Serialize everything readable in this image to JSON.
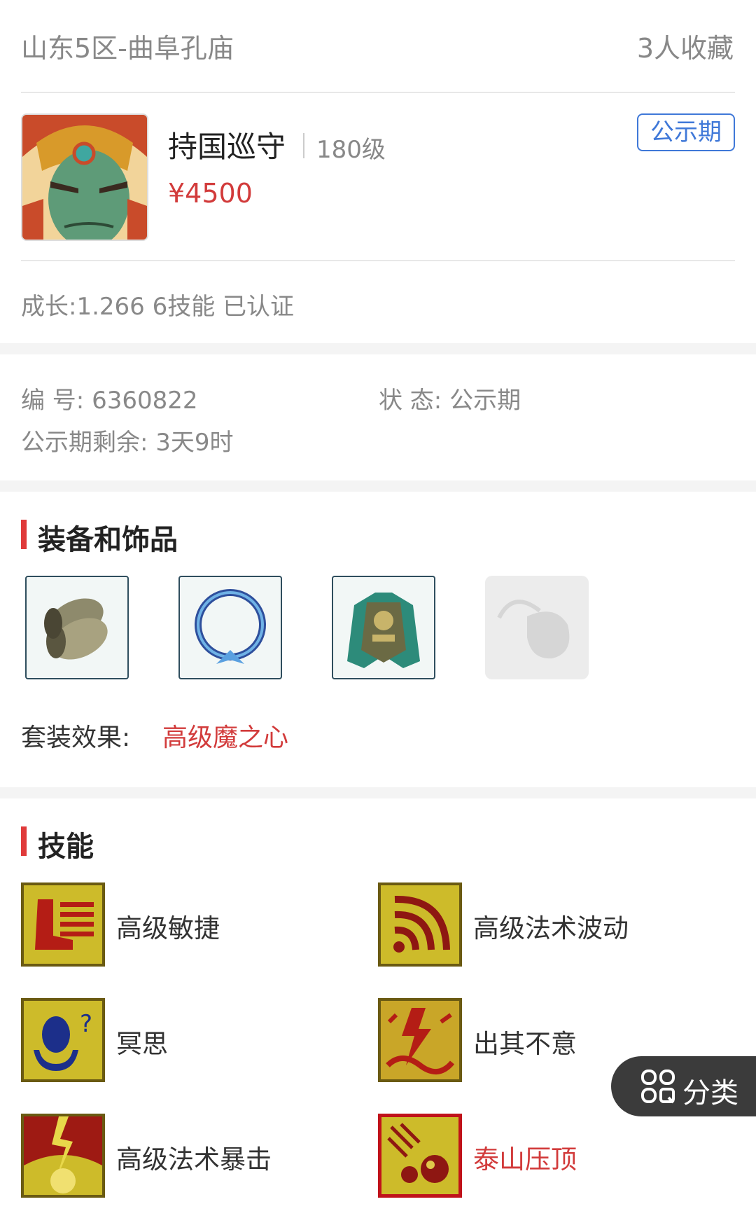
{
  "header": {
    "server": "山东5区-曲阜孔庙",
    "favorites": "3人收藏"
  },
  "item": {
    "name": "持国巡守",
    "level": "180级",
    "price": "¥4500",
    "badge": "公示期",
    "summary": "成长:1.266 6技能 已认证"
  },
  "info": {
    "serial_label": "编 号: ",
    "serial": "6360822",
    "status_label": "状 态: ",
    "status": "公示期",
    "remain_label": "公示期剩余: ",
    "remain": "3天9时"
  },
  "equipment": {
    "title": "装备和饰品",
    "items": [
      "bracer-icon",
      "ring-icon",
      "armor-icon",
      "empty-slot-icon"
    ],
    "set_label": "套装效果:",
    "set_value": "高级魔之心"
  },
  "skills": {
    "title": "技能",
    "items": [
      {
        "name": "高级敏捷",
        "icon": "boot-speed-icon"
      },
      {
        "name": "高级法术波动",
        "icon": "wave-icon"
      },
      {
        "name": "冥思",
        "icon": "meditate-icon"
      },
      {
        "name": "出其不意",
        "icon": "surprise-icon"
      },
      {
        "name": "高级法术暴击",
        "icon": "crit-icon"
      },
      {
        "name": "泰山压顶",
        "icon": "boulder-icon",
        "selected": true
      }
    ]
  },
  "float_button": {
    "label": "分类",
    "icon": "category-grid-icon"
  },
  "colors": {
    "accent": "#d23b3b",
    "badge": "#3f78d8"
  }
}
